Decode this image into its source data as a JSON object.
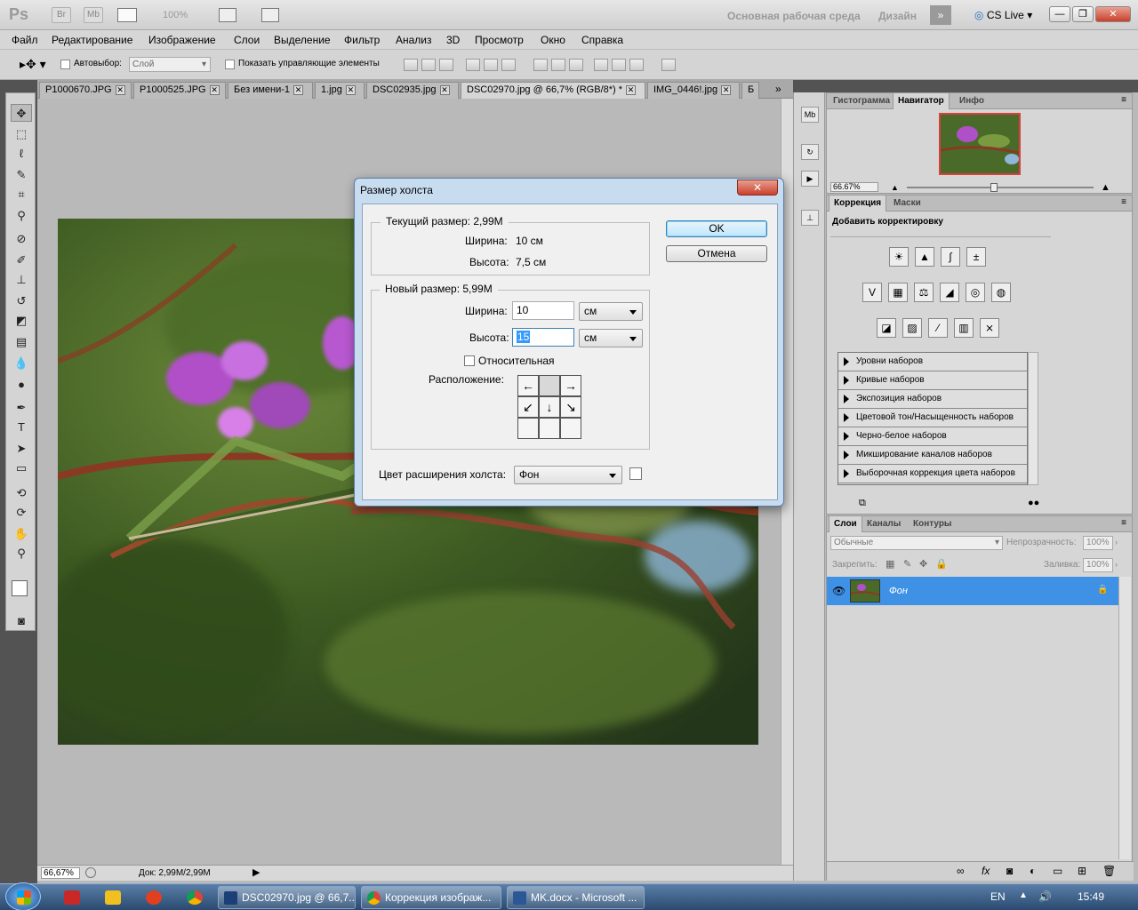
{
  "app": {
    "logo": "Ps",
    "br": "Br",
    "mb": "Mb",
    "zoom": "100%",
    "workspace_main": "Основная рабочая среда",
    "workspace_design": "Дизайн",
    "cslive": "CS Live"
  },
  "menu": [
    "Файл",
    "Редактирование",
    "Изображение",
    "Слои",
    "Выделение",
    "Фильтр",
    "Анализ",
    "3D",
    "Просмотр",
    "Окно",
    "Справка"
  ],
  "options": {
    "autoselect": "Автовыбор:",
    "autoselect_value": "Слой",
    "show_controls": "Показать управляющие элементы"
  },
  "tabs": [
    "P1000670.JPG",
    "P1000525.JPG",
    "Без имени-1",
    "1.jpg",
    "DSC02935.jpg",
    "DSC02970.jpg @ 66,7% (RGB/8*) *",
    "IMG_0446!.jpg",
    "Б"
  ],
  "status": {
    "zoom": "66,67%",
    "doc": "Док: 2,99M/2,99M"
  },
  "navigator": {
    "tabs": [
      "Гистограмма",
      "Навигатор",
      "Инфо"
    ],
    "zoom": "66.67%"
  },
  "adjustments": {
    "tabs": [
      "Коррекция",
      "Маски"
    ],
    "title": "Добавить корректировку",
    "presets": [
      "Уровни наборов",
      "Кривые наборов",
      "Экспозиция наборов",
      "Цветовой тон/Насыщенность наборов",
      "Черно-белое наборов",
      "Микширование каналов наборов",
      "Выборочная коррекция цвета наборов"
    ]
  },
  "layers": {
    "tabs": [
      "Слои",
      "Каналы",
      "Контуры"
    ],
    "blend": "Обычные",
    "opacity_label": "Непрозрачность:",
    "opacity": "100%",
    "lock_label": "Закрепить:",
    "fill_label": "Заливка:",
    "fill": "100%",
    "layer_name": "Фон"
  },
  "dialog": {
    "title": "Размер холста",
    "current_label": "Текущий размер:",
    "current_size": "2,99M",
    "width_label": "Ширина:",
    "height_label": "Высота:",
    "current_width": "10 см",
    "current_height": "7,5 см",
    "new_label": "Новый размер:",
    "new_size": "5,99M",
    "new_width": "10",
    "new_height": "15",
    "unit": "см",
    "relative": "Относительная",
    "anchor_label": "Расположение:",
    "ext_color_label": "Цвет расширения холста:",
    "ext_color": "Фон",
    "ok": "OK",
    "cancel": "Отмена"
  },
  "taskbar": {
    "items": [
      "DSC02970.jpg @ 66,7...",
      "Коррекция изображ...",
      "MK.docx - Microsoft ..."
    ],
    "lang": "EN",
    "time": "15:49"
  }
}
